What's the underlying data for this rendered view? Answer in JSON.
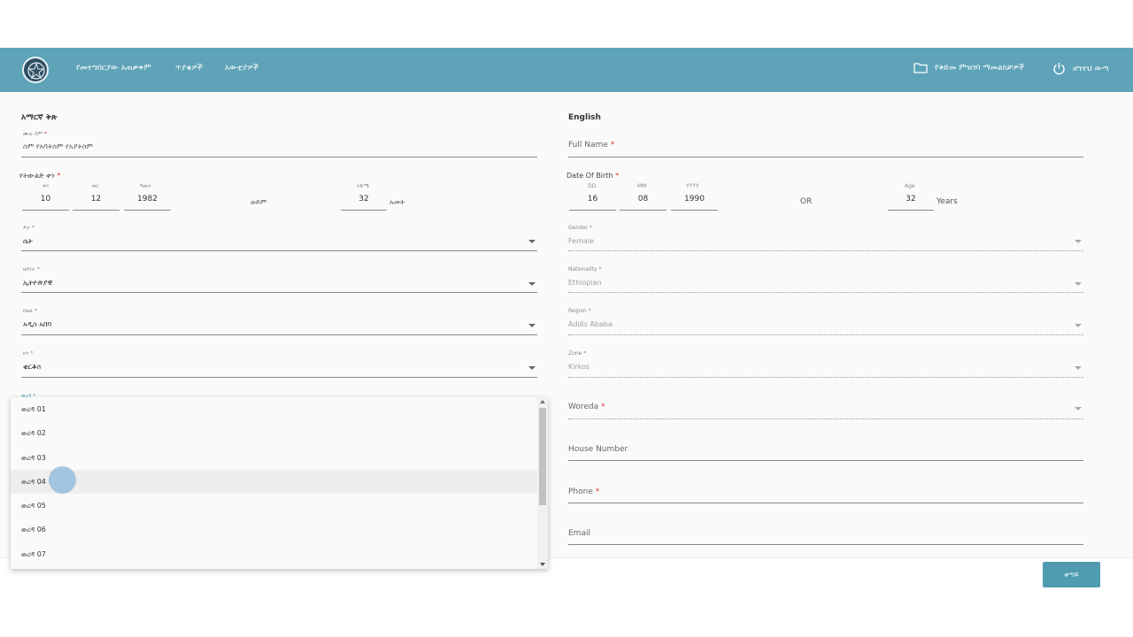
{
  "nav": {
    "items": [
      "የመተግበርያው አጠቃቀም",
      "ጥያቄዎች",
      "አውቲያዎች"
    ],
    "folder_label": "የቅድመ ምዝገባ ማመልከቻዎች",
    "logout_label": "ዘግተህ ውጣ"
  },
  "amharic": {
    "section_title": "አማርኛ ቅጽ",
    "full_name": {
      "label": "ሙሉ ስም",
      "value": "ስም የአባትስም የአያትስም"
    },
    "dob": {
      "label": "የትውልድ ቀን",
      "day_label": "ቀን",
      "day": "10",
      "month_label": "ወር",
      "month": "12",
      "year_label": "ዓመት",
      "year": "1982",
      "or": "ወይም",
      "age_label": "እድሜ",
      "age": "32",
      "age_unit": "አመት"
    },
    "gender": {
      "label": "ፆታ",
      "value": "ሴት"
    },
    "nationality": {
      "label": "ዜግነት",
      "value": "ኢትዮጵያዊ"
    },
    "region": {
      "label": "ክልል",
      "value": "አዲስ አበባ"
    },
    "zone": {
      "label": "ዞን",
      "value": "ቂርቆስ"
    },
    "woreda": {
      "label": "ወረዳ"
    }
  },
  "english": {
    "section_title": "English",
    "full_name": {
      "label": "Full Name"
    },
    "dob": {
      "label": "Date Of Birth",
      "day_label": "DD",
      "day": "16",
      "month_label": "MM",
      "month": "08",
      "year_label": "YYYY",
      "year": "1990",
      "or": "OR",
      "age_label": "Age",
      "age": "32",
      "age_unit": "Years"
    },
    "gender": {
      "label": "Gender",
      "value": "Female"
    },
    "nationality": {
      "label": "Nationality",
      "value": "Ethiopian"
    },
    "region": {
      "label": "Region",
      "value": "Addis Ababa"
    },
    "zone": {
      "label": "Zone",
      "value": "Kirkos"
    },
    "woreda": {
      "label": "Woreda"
    },
    "house_number": {
      "label": "House Number"
    },
    "phone": {
      "label": "Phone"
    },
    "email": {
      "label": "Email"
    }
  },
  "dropdown": {
    "options": [
      "ወረዳ 01",
      "ወረዳ 02",
      "ወረዳ 03",
      "ወረዳ 04",
      "ወረዳ 05",
      "ወረዳ 06",
      "ወረዳ 07"
    ],
    "hovered": "ወረዳ 04"
  },
  "actions": {
    "submit_label": "ቀጣይ"
  },
  "colors": {
    "primary": "#5ea3b8",
    "required": "#dd3333"
  }
}
